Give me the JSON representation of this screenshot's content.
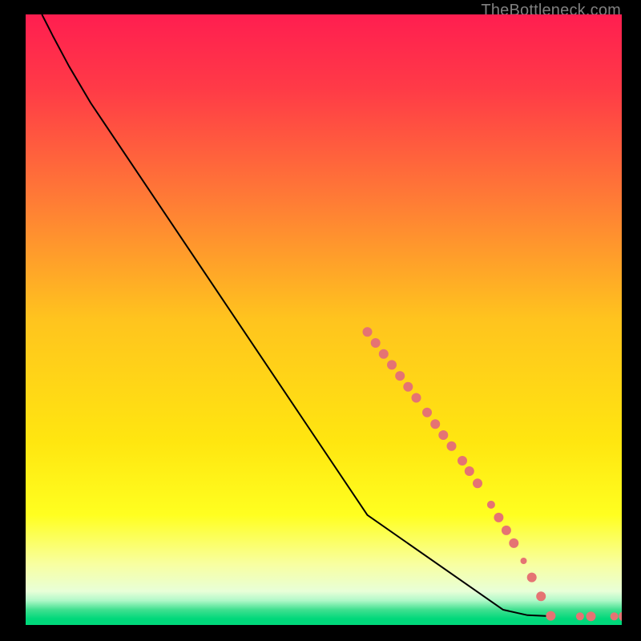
{
  "watermark": "TheBottleneck.com",
  "chart_data": {
    "type": "line",
    "title": "",
    "xlabel": "",
    "ylabel": "",
    "xlim": [
      0,
      100
    ],
    "ylim": [
      0,
      100
    ],
    "background_gradient": {
      "stops": [
        {
          "pos": 0.0,
          "color": "#ff1e50"
        },
        {
          "pos": 0.12,
          "color": "#ff3a47"
        },
        {
          "pos": 0.3,
          "color": "#ff7a36"
        },
        {
          "pos": 0.5,
          "color": "#ffc41e"
        },
        {
          "pos": 0.7,
          "color": "#ffe610"
        },
        {
          "pos": 0.82,
          "color": "#ffff20"
        },
        {
          "pos": 0.9,
          "color": "#f8ffa0"
        },
        {
          "pos": 0.945,
          "color": "#e8ffd8"
        },
        {
          "pos": 0.96,
          "color": "#b0f8c8"
        },
        {
          "pos": 0.975,
          "color": "#40e090"
        },
        {
          "pos": 0.99,
          "color": "#00d87a"
        },
        {
          "pos": 1.0,
          "color": "#00d87a"
        }
      ]
    },
    "curve": {
      "description": "monotone decreasing convex curve from top-left to bottom-right",
      "points": [
        {
          "x": 3.0,
          "y": 100.0
        },
        {
          "x": 5.0,
          "y": 96.5
        },
        {
          "x": 8.0,
          "y": 91.5
        },
        {
          "x": 12.0,
          "y": 85.5
        },
        {
          "x": 63.0,
          "y": 18.0
        },
        {
          "x": 88.0,
          "y": 2.5
        },
        {
          "x": 92.5,
          "y": 1.6
        },
        {
          "x": 97.5,
          "y": 1.4
        }
      ]
    },
    "markers": {
      "color": "#e57373",
      "radius": 6,
      "points": [
        {
          "x": 63.0,
          "y": 48.0,
          "r": 6
        },
        {
          "x": 64.5,
          "y": 46.2,
          "r": 6
        },
        {
          "x": 66.0,
          "y": 44.4,
          "r": 6
        },
        {
          "x": 67.5,
          "y": 42.6,
          "r": 6
        },
        {
          "x": 69.0,
          "y": 40.8,
          "r": 6
        },
        {
          "x": 70.5,
          "y": 39.0,
          "r": 6
        },
        {
          "x": 72.0,
          "y": 37.2,
          "r": 6
        },
        {
          "x": 74.0,
          "y": 34.8,
          "r": 6
        },
        {
          "x": 75.5,
          "y": 32.9,
          "r": 6
        },
        {
          "x": 77.0,
          "y": 31.1,
          "r": 6
        },
        {
          "x": 78.5,
          "y": 29.3,
          "r": 6
        },
        {
          "x": 80.5,
          "y": 26.9,
          "r": 6
        },
        {
          "x": 81.8,
          "y": 25.2,
          "r": 6
        },
        {
          "x": 83.3,
          "y": 23.2,
          "r": 6
        },
        {
          "x": 85.8,
          "y": 19.7,
          "r": 5
        },
        {
          "x": 87.2,
          "y": 17.6,
          "r": 6
        },
        {
          "x": 88.6,
          "y": 15.5,
          "r": 6
        },
        {
          "x": 90.0,
          "y": 13.4,
          "r": 6
        },
        {
          "x": 91.8,
          "y": 10.5,
          "r": 4
        },
        {
          "x": 93.3,
          "y": 7.8,
          "r": 6
        },
        {
          "x": 95.0,
          "y": 4.7,
          "r": 6
        },
        {
          "x": 96.8,
          "y": 1.5,
          "r": 6
        },
        {
          "x": 102.2,
          "y": 1.4,
          "r": 5
        },
        {
          "x": 104.2,
          "y": 1.4,
          "r": 6
        },
        {
          "x": 108.5,
          "y": 1.4,
          "r": 5
        },
        {
          "x": 110.2,
          "y": 1.4,
          "r": 6
        }
      ]
    }
  }
}
